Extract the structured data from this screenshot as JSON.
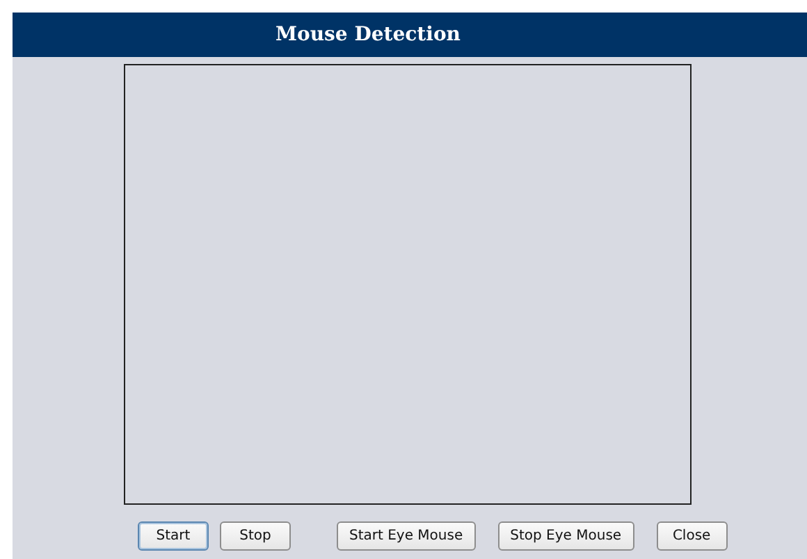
{
  "window": {
    "title": "Mouse Detection"
  },
  "buttons": [
    {
      "label": "Start",
      "focused": true
    },
    {
      "label": "Stop",
      "focused": false
    },
    {
      "label": "Start Eye Mouse",
      "focused": false
    },
    {
      "label": "Stop Eye Mouse",
      "focused": false
    },
    {
      "label": "Close",
      "focused": false
    }
  ]
}
